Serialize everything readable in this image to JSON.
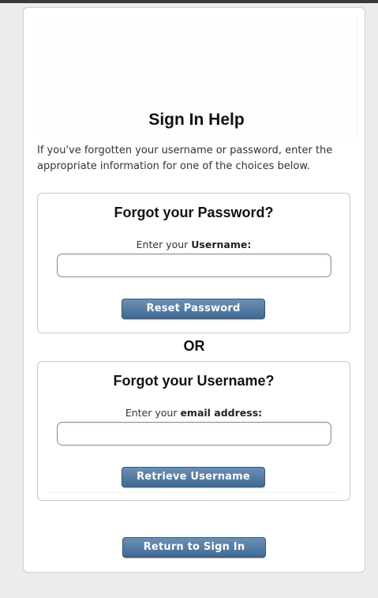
{
  "page": {
    "title": "Sign In Help",
    "intro": "If you've forgotten your username or password, enter the appropriate information for one of the choices below.",
    "separator": "OR"
  },
  "password_section": {
    "title": "Forgot your Password?",
    "label_prefix": "Enter your ",
    "label_bold": "Username:",
    "input_value": "",
    "button": "Reset Password"
  },
  "username_section": {
    "title": "Forgot your Username?",
    "label_prefix": "Enter your ",
    "label_bold": "email address:",
    "input_value": "",
    "button": "Retrieve Username"
  },
  "footer": {
    "return_button": "Return to Sign In"
  },
  "colors": {
    "button": "#4f78a0",
    "background": "#ececec",
    "card": "#ffffff"
  }
}
